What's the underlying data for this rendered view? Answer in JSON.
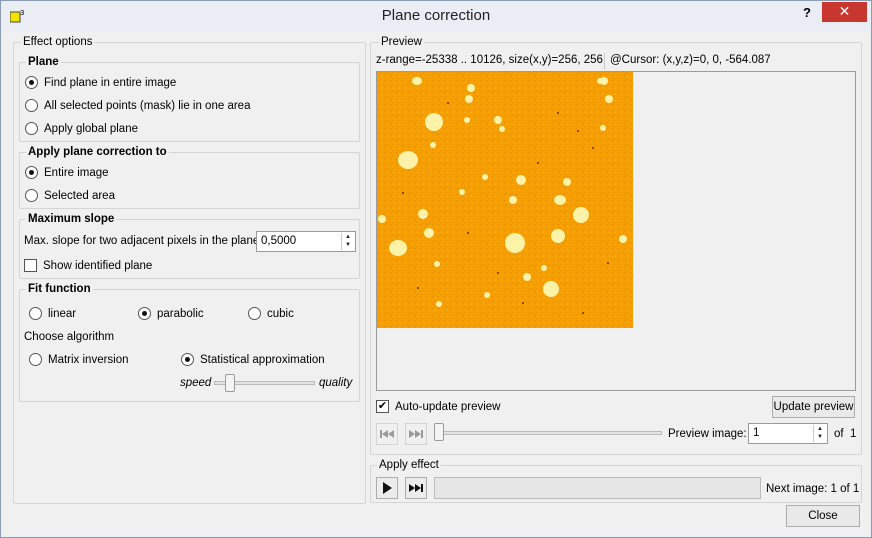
{
  "window": {
    "title": "Plane correction",
    "help_label": "?",
    "close_label": "✕"
  },
  "effect_options": {
    "label": "Effect options",
    "plane": {
      "label": "Plane",
      "options": [
        "Find plane in entire image",
        "All selected points (mask) lie in one area",
        "Apply global plane"
      ],
      "selected": "Find plane in entire image"
    },
    "apply_to": {
      "label": "Apply plane correction to",
      "options": [
        "Entire image",
        "Selected area"
      ],
      "selected": "Entire image"
    },
    "max_slope": {
      "label": "Maximum slope",
      "field_label": "Max. slope for two adjacent pixels in the plane:",
      "value": "0,5000",
      "show_plane_label": "Show identified plane",
      "show_plane_checked": false
    },
    "fit_function": {
      "label": "Fit function",
      "options": [
        "linear",
        "parabolic",
        "cubic"
      ],
      "selected": "parabolic",
      "algorithm_label": "Choose algorithm",
      "algorithms": [
        "Matrix inversion",
        "Statistical approximation"
      ],
      "algorithm_selected": "Statistical approximation",
      "speed_label": "speed",
      "quality_label": "quality",
      "speed_quality_level": 0.0
    }
  },
  "preview": {
    "label": "Preview",
    "z_range_text": "z-range=-25338 .. 10126, size(x,y)=256, 256",
    "cursor_text": "@Cursor: (x,y,z)=0, 0, -564.087",
    "auto_update_label": "Auto-update preview",
    "auto_update_checked": true,
    "update_button": "Update preview",
    "preview_image_label": "Preview image:",
    "preview_image_value": "1",
    "of_label": "of",
    "total": "1",
    "first_icon": "skip-back-icon",
    "last_icon": "skip-forward-icon"
  },
  "apply_effect": {
    "label": "Apply effect",
    "play_icon": "play-icon",
    "skip_icon": "skip-forward-icon",
    "next_image_text": "Next image: 1 of 1",
    "progress": 0
  },
  "footer": {
    "close_button": "Close"
  },
  "colors": {
    "image_base": "#f6a100",
    "particle": "#fdf3a8",
    "close_red": "#c7372f"
  }
}
